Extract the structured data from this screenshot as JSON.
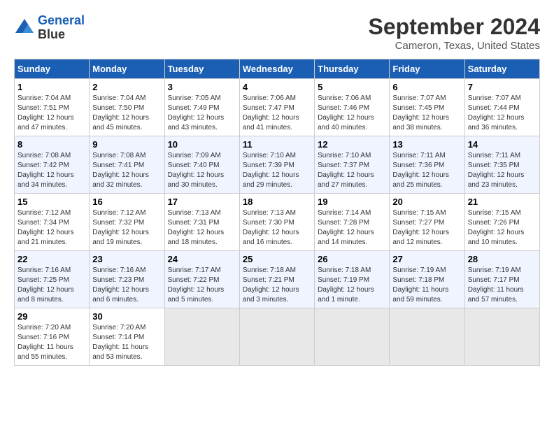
{
  "header": {
    "logo_line1": "General",
    "logo_line2": "Blue",
    "title": "September 2024",
    "subtitle": "Cameron, Texas, United States"
  },
  "calendar": {
    "days_of_week": [
      "Sunday",
      "Monday",
      "Tuesday",
      "Wednesday",
      "Thursday",
      "Friday",
      "Saturday"
    ],
    "weeks": [
      [
        null,
        {
          "day": 2,
          "sunrise": "7:04 AM",
          "sunset": "7:50 PM",
          "daylight": "12 hours and 45 minutes."
        },
        {
          "day": 3,
          "sunrise": "7:05 AM",
          "sunset": "7:49 PM",
          "daylight": "12 hours and 43 minutes."
        },
        {
          "day": 4,
          "sunrise": "7:06 AM",
          "sunset": "7:47 PM",
          "daylight": "12 hours and 41 minutes."
        },
        {
          "day": 5,
          "sunrise": "7:06 AM",
          "sunset": "7:46 PM",
          "daylight": "12 hours and 40 minutes."
        },
        {
          "day": 6,
          "sunrise": "7:07 AM",
          "sunset": "7:45 PM",
          "daylight": "12 hours and 38 minutes."
        },
        {
          "day": 7,
          "sunrise": "7:07 AM",
          "sunset": "7:44 PM",
          "daylight": "12 hours and 36 minutes."
        },
        {
          "day": 1,
          "sunrise": "7:04 AM",
          "sunset": "7:51 PM",
          "daylight": "12 hours and 47 minutes.",
          "col": 0
        }
      ],
      [
        {
          "day": 8,
          "sunrise": "7:08 AM",
          "sunset": "7:42 PM",
          "daylight": "12 hours and 34 minutes."
        },
        {
          "day": 9,
          "sunrise": "7:08 AM",
          "sunset": "7:41 PM",
          "daylight": "12 hours and 32 minutes."
        },
        {
          "day": 10,
          "sunrise": "7:09 AM",
          "sunset": "7:40 PM",
          "daylight": "12 hours and 30 minutes."
        },
        {
          "day": 11,
          "sunrise": "7:10 AM",
          "sunset": "7:39 PM",
          "daylight": "12 hours and 29 minutes."
        },
        {
          "day": 12,
          "sunrise": "7:10 AM",
          "sunset": "7:37 PM",
          "daylight": "12 hours and 27 minutes."
        },
        {
          "day": 13,
          "sunrise": "7:11 AM",
          "sunset": "7:36 PM",
          "daylight": "12 hours and 25 minutes."
        },
        {
          "day": 14,
          "sunrise": "7:11 AM",
          "sunset": "7:35 PM",
          "daylight": "12 hours and 23 minutes."
        }
      ],
      [
        {
          "day": 15,
          "sunrise": "7:12 AM",
          "sunset": "7:34 PM",
          "daylight": "12 hours and 21 minutes."
        },
        {
          "day": 16,
          "sunrise": "7:12 AM",
          "sunset": "7:32 PM",
          "daylight": "12 hours and 19 minutes."
        },
        {
          "day": 17,
          "sunrise": "7:13 AM",
          "sunset": "7:31 PM",
          "daylight": "12 hours and 18 minutes."
        },
        {
          "day": 18,
          "sunrise": "7:13 AM",
          "sunset": "7:30 PM",
          "daylight": "12 hours and 16 minutes."
        },
        {
          "day": 19,
          "sunrise": "7:14 AM",
          "sunset": "7:28 PM",
          "daylight": "12 hours and 14 minutes."
        },
        {
          "day": 20,
          "sunrise": "7:15 AM",
          "sunset": "7:27 PM",
          "daylight": "12 hours and 12 minutes."
        },
        {
          "day": 21,
          "sunrise": "7:15 AM",
          "sunset": "7:26 PM",
          "daylight": "12 hours and 10 minutes."
        }
      ],
      [
        {
          "day": 22,
          "sunrise": "7:16 AM",
          "sunset": "7:25 PM",
          "daylight": "12 hours and 8 minutes."
        },
        {
          "day": 23,
          "sunrise": "7:16 AM",
          "sunset": "7:23 PM",
          "daylight": "12 hours and 6 minutes."
        },
        {
          "day": 24,
          "sunrise": "7:17 AM",
          "sunset": "7:22 PM",
          "daylight": "12 hours and 5 minutes."
        },
        {
          "day": 25,
          "sunrise": "7:18 AM",
          "sunset": "7:21 PM",
          "daylight": "12 hours and 3 minutes."
        },
        {
          "day": 26,
          "sunrise": "7:18 AM",
          "sunset": "7:19 PM",
          "daylight": "12 hours and 1 minute."
        },
        {
          "day": 27,
          "sunrise": "7:19 AM",
          "sunset": "7:18 PM",
          "daylight": "11 hours and 59 minutes."
        },
        {
          "day": 28,
          "sunrise": "7:19 AM",
          "sunset": "7:17 PM",
          "daylight": "11 hours and 57 minutes."
        }
      ],
      [
        {
          "day": 29,
          "sunrise": "7:20 AM",
          "sunset": "7:16 PM",
          "daylight": "11 hours and 55 minutes."
        },
        {
          "day": 30,
          "sunrise": "7:20 AM",
          "sunset": "7:14 PM",
          "daylight": "11 hours and 53 minutes."
        },
        null,
        null,
        null,
        null,
        null
      ]
    ]
  }
}
